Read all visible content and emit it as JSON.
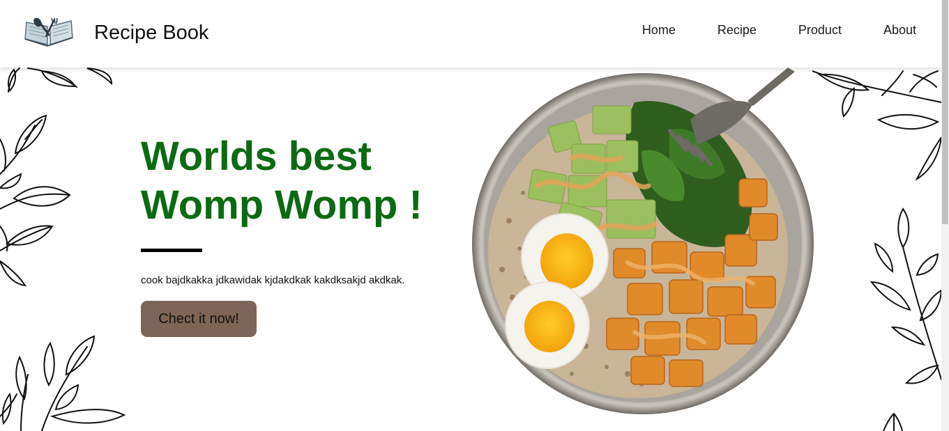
{
  "header": {
    "brand": "Recipe Book",
    "logo_icon": "open-book-icon",
    "nav": [
      "Home",
      "Recipe",
      "Product",
      "About"
    ]
  },
  "hero": {
    "title_line1": "Worlds best",
    "title_line2": "Womp Womp !",
    "text": "cook bajdkakka jdkawidak kjdakdkak kakdksakjd akdkak.",
    "button_label": "Chect it now!"
  },
  "colors": {
    "title": "#0c6a12",
    "button": "#7d6657",
    "header_bg": "#ffffff"
  }
}
